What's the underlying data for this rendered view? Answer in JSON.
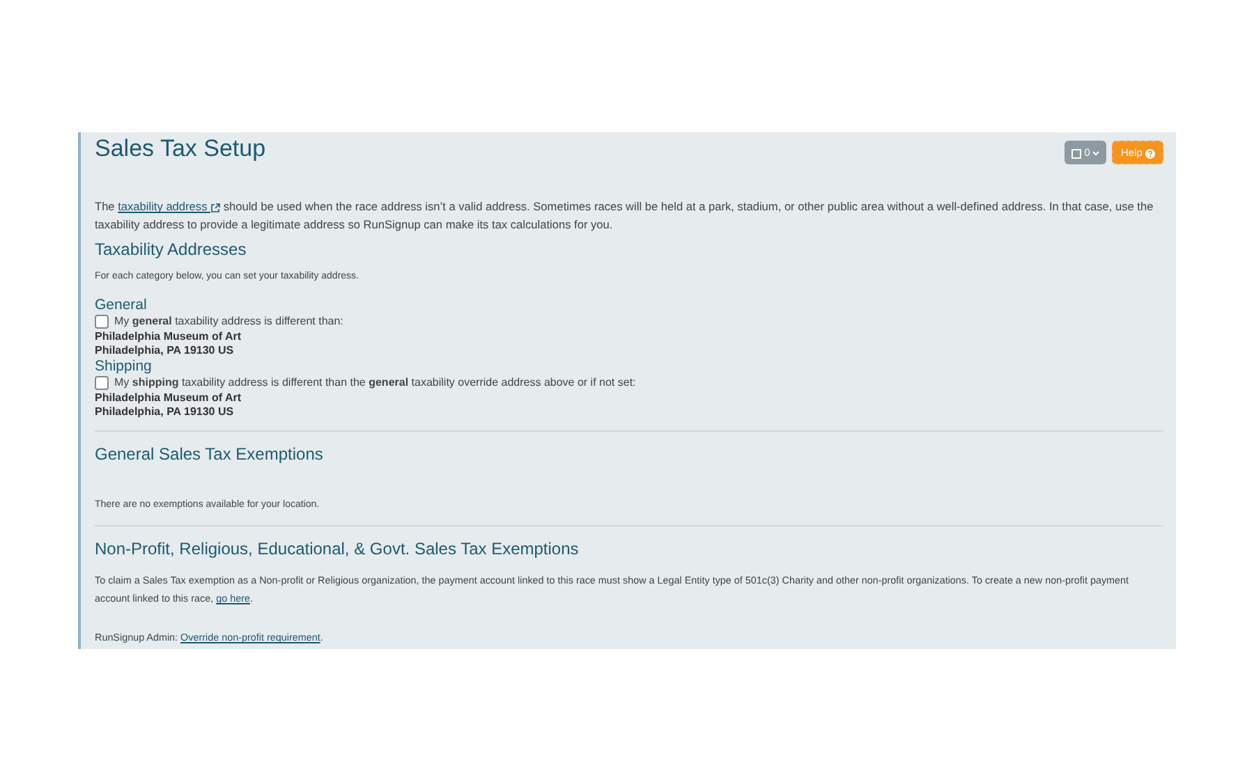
{
  "page_title": "Sales Tax Setup",
  "toolbar": {
    "count_button": {
      "label": "0"
    },
    "help_button": {
      "label": "Help"
    }
  },
  "intro": {
    "before": "The ",
    "link": "taxability address",
    "after": " should be used when the race address isn’t a valid address. Sometimes races will be held at a park, stadium, or other public area without a well-defined address. In that case, use the taxability address to provide a legitimate address so RunSignup can make its tax calculations for you."
  },
  "taxability": {
    "heading": "Taxability Addresses",
    "note": "For each category below, you can set your taxability address.",
    "categories": [
      {
        "heading": "General",
        "checkbox_label": "My **general** taxability address is different than:",
        "checked": false,
        "address": [
          "Philadelphia Museum of Art",
          "Philadelphia, PA 19130 US"
        ]
      },
      {
        "heading": "Shipping",
        "checkbox_label": "My **shipping** taxability address is different than the **general** taxability override address above or if not set:",
        "checked": false,
        "address": [
          "Philadelphia Museum of Art",
          "Philadelphia, PA 19130 US"
        ]
      }
    ]
  },
  "general_exemptions": {
    "heading": "General Sales Tax Exemptions",
    "note": "There are no exemptions available for your location."
  },
  "nonprofit_exemptions": {
    "heading": "Non-Profit, Religious, Educational, & Govt. Sales Tax Exemptions",
    "text": {
      "before": "To claim a Sales Tax exemption as a Non-profit or Religious organization, the payment account linked to this race must show a Legal Entity type of 501c(3) Charity and other non-profit organizations. To create a new non-profit payment account linked to this race, ",
      "link": "go here",
      "after": "."
    },
    "admin": {
      "before": "RunSignup Admin: ",
      "link": "Override non-profit requirement",
      "after": "."
    }
  }
}
